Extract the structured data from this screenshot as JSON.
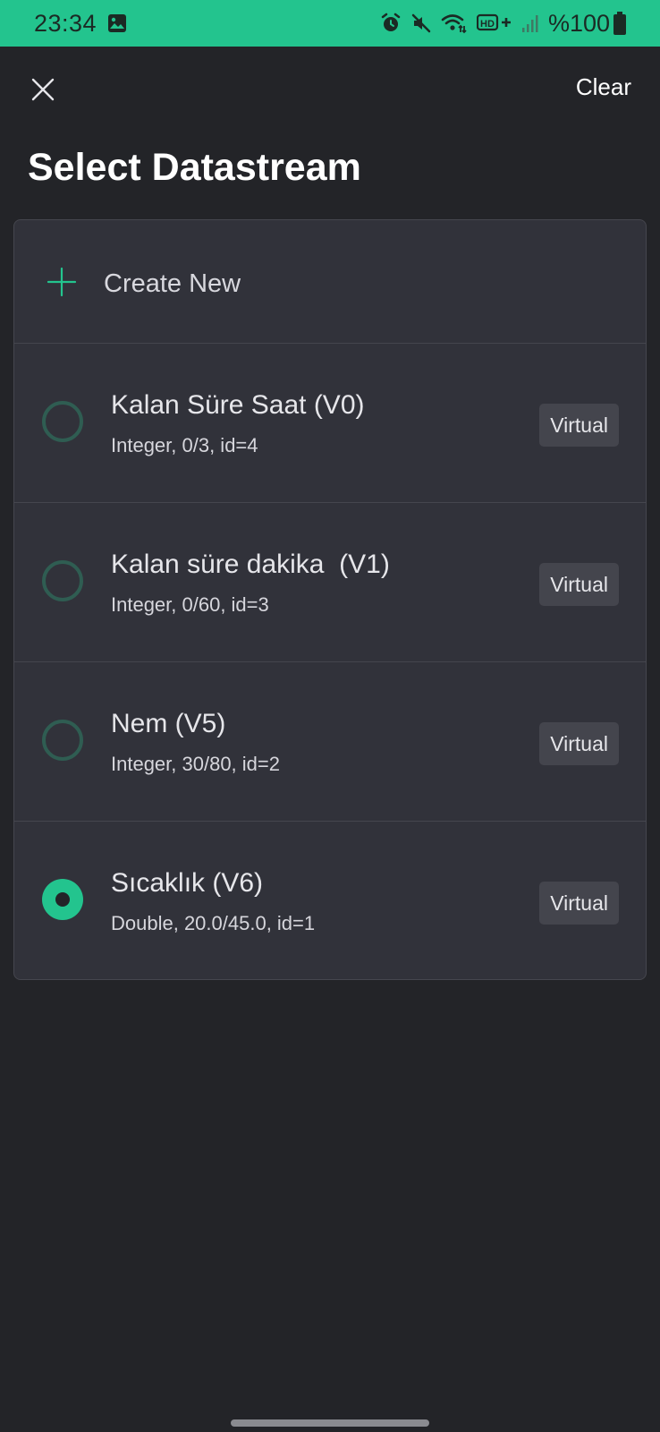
{
  "status_bar": {
    "time": "23:34",
    "battery_text": "%100",
    "icons": [
      "gallery-icon",
      "alarm-icon",
      "mute-icon",
      "wifi-icon",
      "hd-plus-icon",
      "signal-icon",
      "battery-icon"
    ],
    "background": "#23c48e"
  },
  "header": {
    "close_icon": "close-icon",
    "clear_label": "Clear",
    "title": "Select Datastream"
  },
  "create_new": {
    "icon": "plus-icon",
    "label": "Create New"
  },
  "datastreams": [
    {
      "name": "Kalan Süre Saat (V0)",
      "meta": "Integer, 0/3, id=4",
      "badge": "Virtual",
      "selected": false
    },
    {
      "name": "Kalan süre dakika  (V1)",
      "meta": "Integer, 0/60, id=3",
      "badge": "Virtual",
      "selected": false
    },
    {
      "name": "Nem (V5)",
      "meta": "Integer, 30/80, id=2",
      "badge": "Virtual",
      "selected": false
    },
    {
      "name": "Sıcaklık (V6)",
      "meta": "Double, 20.0/45.0, id=1",
      "badge": "Virtual",
      "selected": true
    }
  ],
  "colors": {
    "accent": "#23c48e",
    "background": "#232428",
    "card": "#31323a"
  }
}
